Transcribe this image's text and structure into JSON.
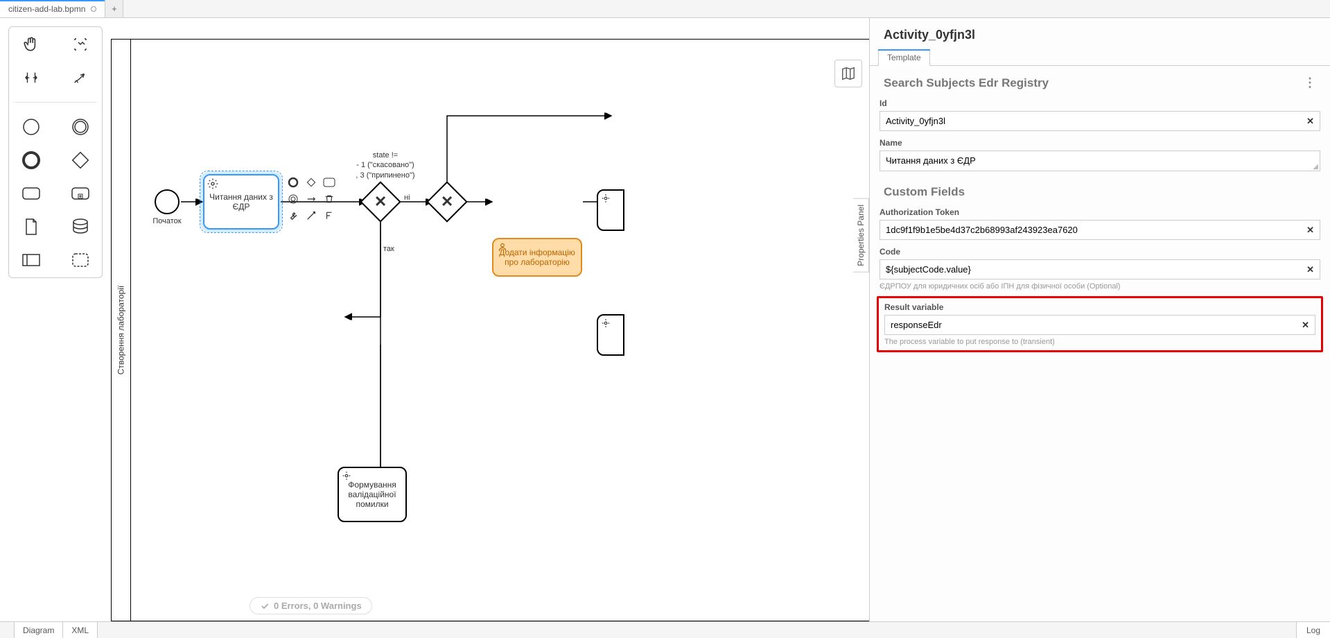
{
  "tabs": {
    "file": "citizen-add-lab.bpmn",
    "add": "+"
  },
  "lane": {
    "title": "Створення лабораторії"
  },
  "diagram": {
    "start_label": "Початок",
    "task_read_edr": "Читання даних з ЄДР",
    "condition_text": "state !=\n- 1 (\"скасовано\")\n, 3 (\"припинено\")",
    "edge_no": "ні",
    "edge_yes": "так",
    "task_add_lab": "Додати інформацію про лабораторію",
    "task_validation": "Формування валідаційної помилки",
    "status": "0 Errors, 0 Warnings",
    "properties_toggle": "Properties Panel"
  },
  "panel": {
    "title": "Activity_0yfjn3l",
    "tab": "Template",
    "section1": "Search Subjects Edr Registry",
    "id_label": "Id",
    "id_value": "Activity_0yfjn3l",
    "name_label": "Name",
    "name_value": "Читання даних з ЄДР",
    "section2": "Custom Fields",
    "auth_label": "Authorization Token",
    "auth_value": "1dc9f1f9b1e5be4d37c2b68993af243923ea7620",
    "code_label": "Code",
    "code_value": "${subjectCode.value}",
    "code_hint": "ЄДРПОУ для юридичних осіб або ІПН для фізичної особи (Optional)",
    "result_label": "Result variable",
    "result_value": "responseEdr",
    "result_hint": "The process variable to put response to (transient)"
  },
  "bottom": {
    "diagram": "Diagram",
    "xml": "XML",
    "log": "Log"
  }
}
